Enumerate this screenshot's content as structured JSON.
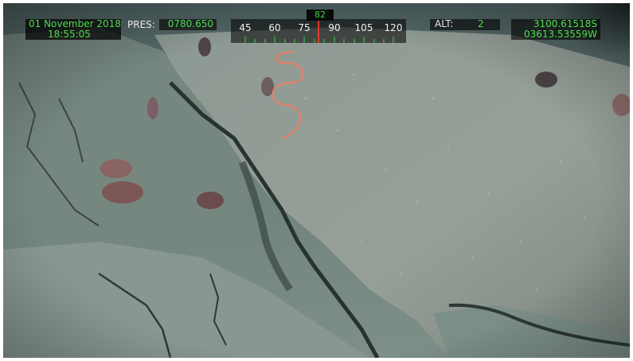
{
  "overlay": {
    "date": "01 November 2018",
    "time": "18:55:05",
    "pressure_label": "PRES:",
    "pressure_value": "0780.650",
    "heading_value": "82",
    "heading_ticks": [
      "45",
      "60",
      "75",
      "90",
      "105",
      "120"
    ],
    "altitude_label": "ALT:",
    "altitude_value": "2",
    "latitude": "3100.61518S",
    "longitude": "03613.53559W"
  },
  "colors": {
    "hud_text": "#4fdc4f",
    "hud_label": "#e8e8e8",
    "heading_marker": "#e03a2a",
    "seafloor": "#7a8c86",
    "rock_shelf": "#8f9a92",
    "crevice": "#2a3230",
    "fish": "#8a5a5a",
    "coral_spiral": "#e0826a"
  }
}
